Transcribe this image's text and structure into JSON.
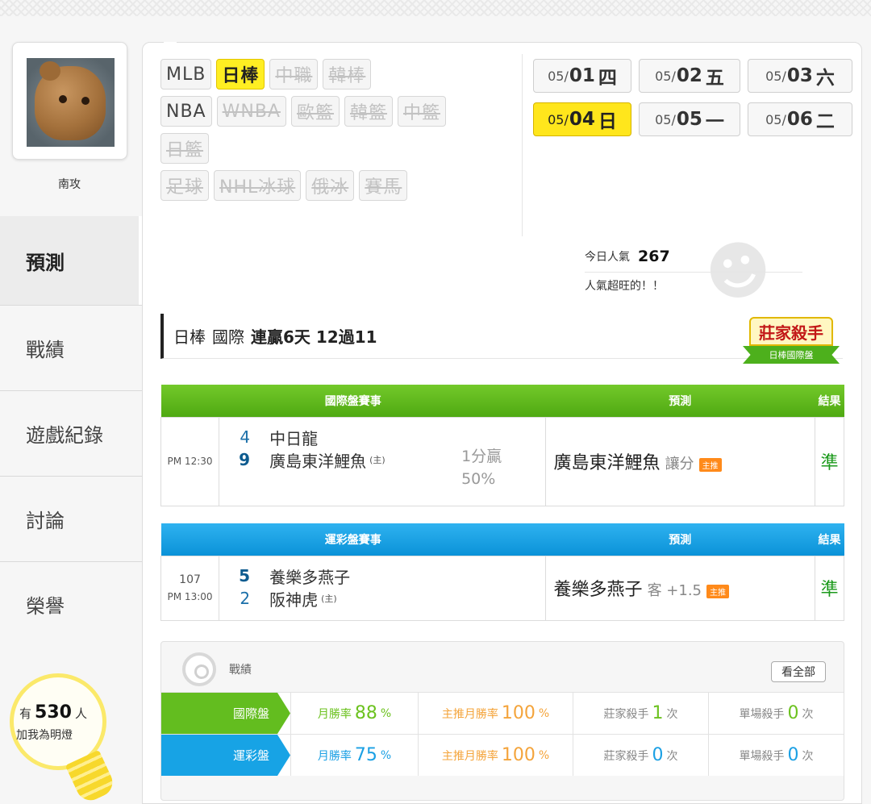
{
  "user": {
    "name": "南攻"
  },
  "nav": [
    {
      "label": "預測",
      "active": true
    },
    {
      "label": "戰績"
    },
    {
      "label": "遊戲紀錄"
    },
    {
      "label": "討論"
    },
    {
      "label": "榮譽"
    }
  ],
  "fans": {
    "prefix": "有",
    "count": "530",
    "suffix": "人",
    "cta": "加我為明燈"
  },
  "sports": {
    "row1": [
      "MLB",
      "日棒",
      "中職",
      "韓棒"
    ],
    "row2": [
      "NBA",
      "WNBA",
      "歐籃",
      "韓籃",
      "中籃"
    ],
    "row3": [
      "日籃"
    ],
    "row4": [
      "足球",
      "NHL冰球",
      "俄冰",
      "賽馬"
    ]
  },
  "dates": [
    {
      "pre": "05/",
      "day": "01",
      "wk": "四"
    },
    {
      "pre": "05/",
      "day": "02",
      "wk": "五"
    },
    {
      "pre": "05/",
      "day": "03",
      "wk": "六"
    },
    {
      "pre": "05/",
      "day": "04",
      "wk": "日",
      "active": true
    },
    {
      "pre": "05/",
      "day": "05",
      "wk": "一"
    },
    {
      "pre": "05/",
      "day": "06",
      "wk": "二"
    }
  ],
  "popularity": {
    "label": "今日人氣",
    "value": "267",
    "note": "人氣超旺的！！"
  },
  "streak": {
    "league": "日棒",
    "type": "國際",
    "text": "連贏6天 12過11"
  },
  "badge": {
    "title": "莊家殺手",
    "sub": "日棒國際盤"
  },
  "intl_table": {
    "headers": [
      "國際盤賽事",
      "預測",
      "結果"
    ],
    "time": "PM 12:30",
    "away": {
      "score": "4",
      "team": "中日龍"
    },
    "home": {
      "score": "9",
      "team": "廣島東洋鯉魚",
      "tag": "(主)"
    },
    "handicap1": "1分贏",
    "handicap2": "50%",
    "pred_team": "廣島東洋鯉魚",
    "pred_sub": "讓分",
    "hot": "主推",
    "result": "準"
  },
  "lottery_table": {
    "headers": [
      "運彩盤賽事",
      "預測",
      "結果"
    ],
    "game_no": "107",
    "time": "PM 13:00",
    "away": {
      "score": "5",
      "team": "養樂多燕子"
    },
    "home": {
      "score": "2",
      "team": "阪神虎",
      "tag": "(主)"
    },
    "pred_team": "養樂多燕子",
    "pred_sub": "客 +1.5",
    "hot": "主推",
    "result": "準"
  },
  "stats": {
    "title": "戰績",
    "view_all": "看全部",
    "rows": [
      {
        "label": "國際盤",
        "month_label": "月勝率",
        "month": "88",
        "pct": "%",
        "main_label": "主推月勝率",
        "main": "100",
        "main_pct": "%",
        "killer_label": "莊家殺手",
        "killer": "1",
        "times": "次",
        "single_label": "單場殺手",
        "single": "0",
        "times2": "次"
      },
      {
        "label": "運彩盤",
        "month_label": "月勝率",
        "month": "75",
        "pct": "%",
        "main_label": "主推月勝率",
        "main": "100",
        "main_pct": "%",
        "killer_label": "莊家殺手",
        "killer": "0",
        "times": "次",
        "single_label": "單場殺手",
        "single": "0",
        "times2": "次"
      }
    ]
  }
}
